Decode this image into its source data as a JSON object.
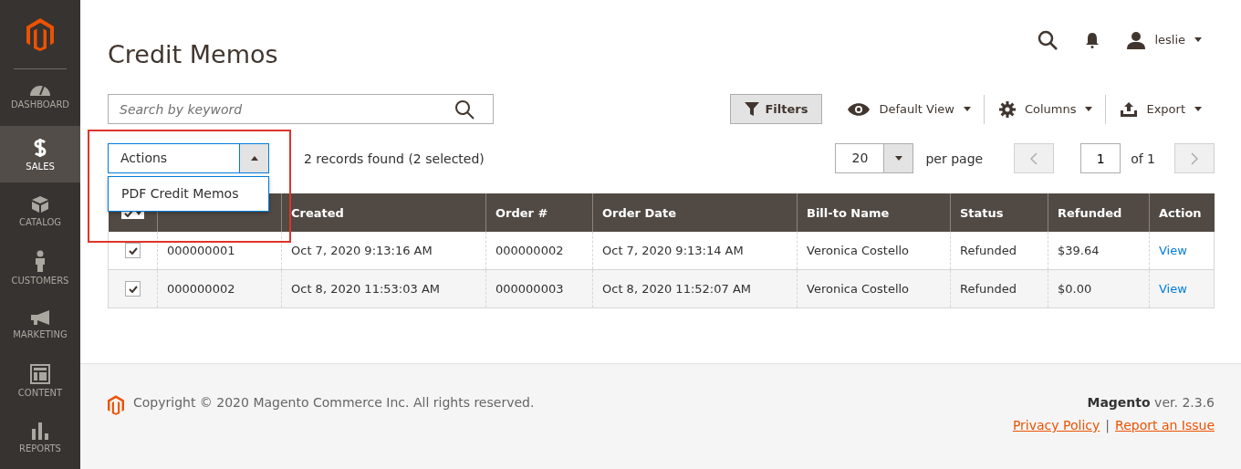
{
  "sidebar": {
    "items": [
      {
        "label": "DASHBOARD",
        "selected": false
      },
      {
        "label": "SALES",
        "selected": true
      },
      {
        "label": "CATALOG",
        "selected": false
      },
      {
        "label": "CUSTOMERS",
        "selected": false
      },
      {
        "label": "MARKETING",
        "selected": false
      },
      {
        "label": "CONTENT",
        "selected": false
      },
      {
        "label": "REPORTS",
        "selected": false
      }
    ]
  },
  "page_title": "Credit Memos",
  "header": {
    "user": "leslie"
  },
  "search": {
    "placeholder": "Search by keyword"
  },
  "toolbar": {
    "filters": "Filters",
    "view": "Default View",
    "columns": "Columns",
    "export": "Export"
  },
  "actions": {
    "label": "Actions",
    "expanded": true,
    "options": [
      "PDF Credit Memos"
    ]
  },
  "records": "2 records found (2 selected)",
  "pagination": {
    "per_page_value": "20",
    "per_page_label": "per page",
    "page": "1",
    "of": "of 1"
  },
  "table": {
    "all_checked": true,
    "columns": [
      "",
      "Created",
      "Order #",
      "Order Date",
      "Bill-to Name",
      "Status",
      "Refunded",
      "Action"
    ],
    "rows": [
      {
        "checked": true,
        "cells": [
          "000000001",
          "Oct 7, 2020 9:13:16 AM",
          "000000002",
          "Oct 7, 2020 9:13:14 AM",
          "Veronica Costello",
          "Refunded",
          "$39.64"
        ],
        "link": "View"
      },
      {
        "checked": true,
        "cells": [
          "000000002",
          "Oct 8, 2020 11:53:03 AM",
          "000000003",
          "Oct 8, 2020 11:52:07 AM",
          "Veronica Costello",
          "Refunded",
          "$0.00"
        ],
        "link": "View"
      }
    ]
  },
  "footer": {
    "copyright": "Copyright © 2020 Magento Commerce Inc. All rights reserved.",
    "version": "**Magento** ver. 2.3.6",
    "links": [
      "Privacy Policy",
      "Report an Issue"
    ],
    "separator": "|"
  }
}
